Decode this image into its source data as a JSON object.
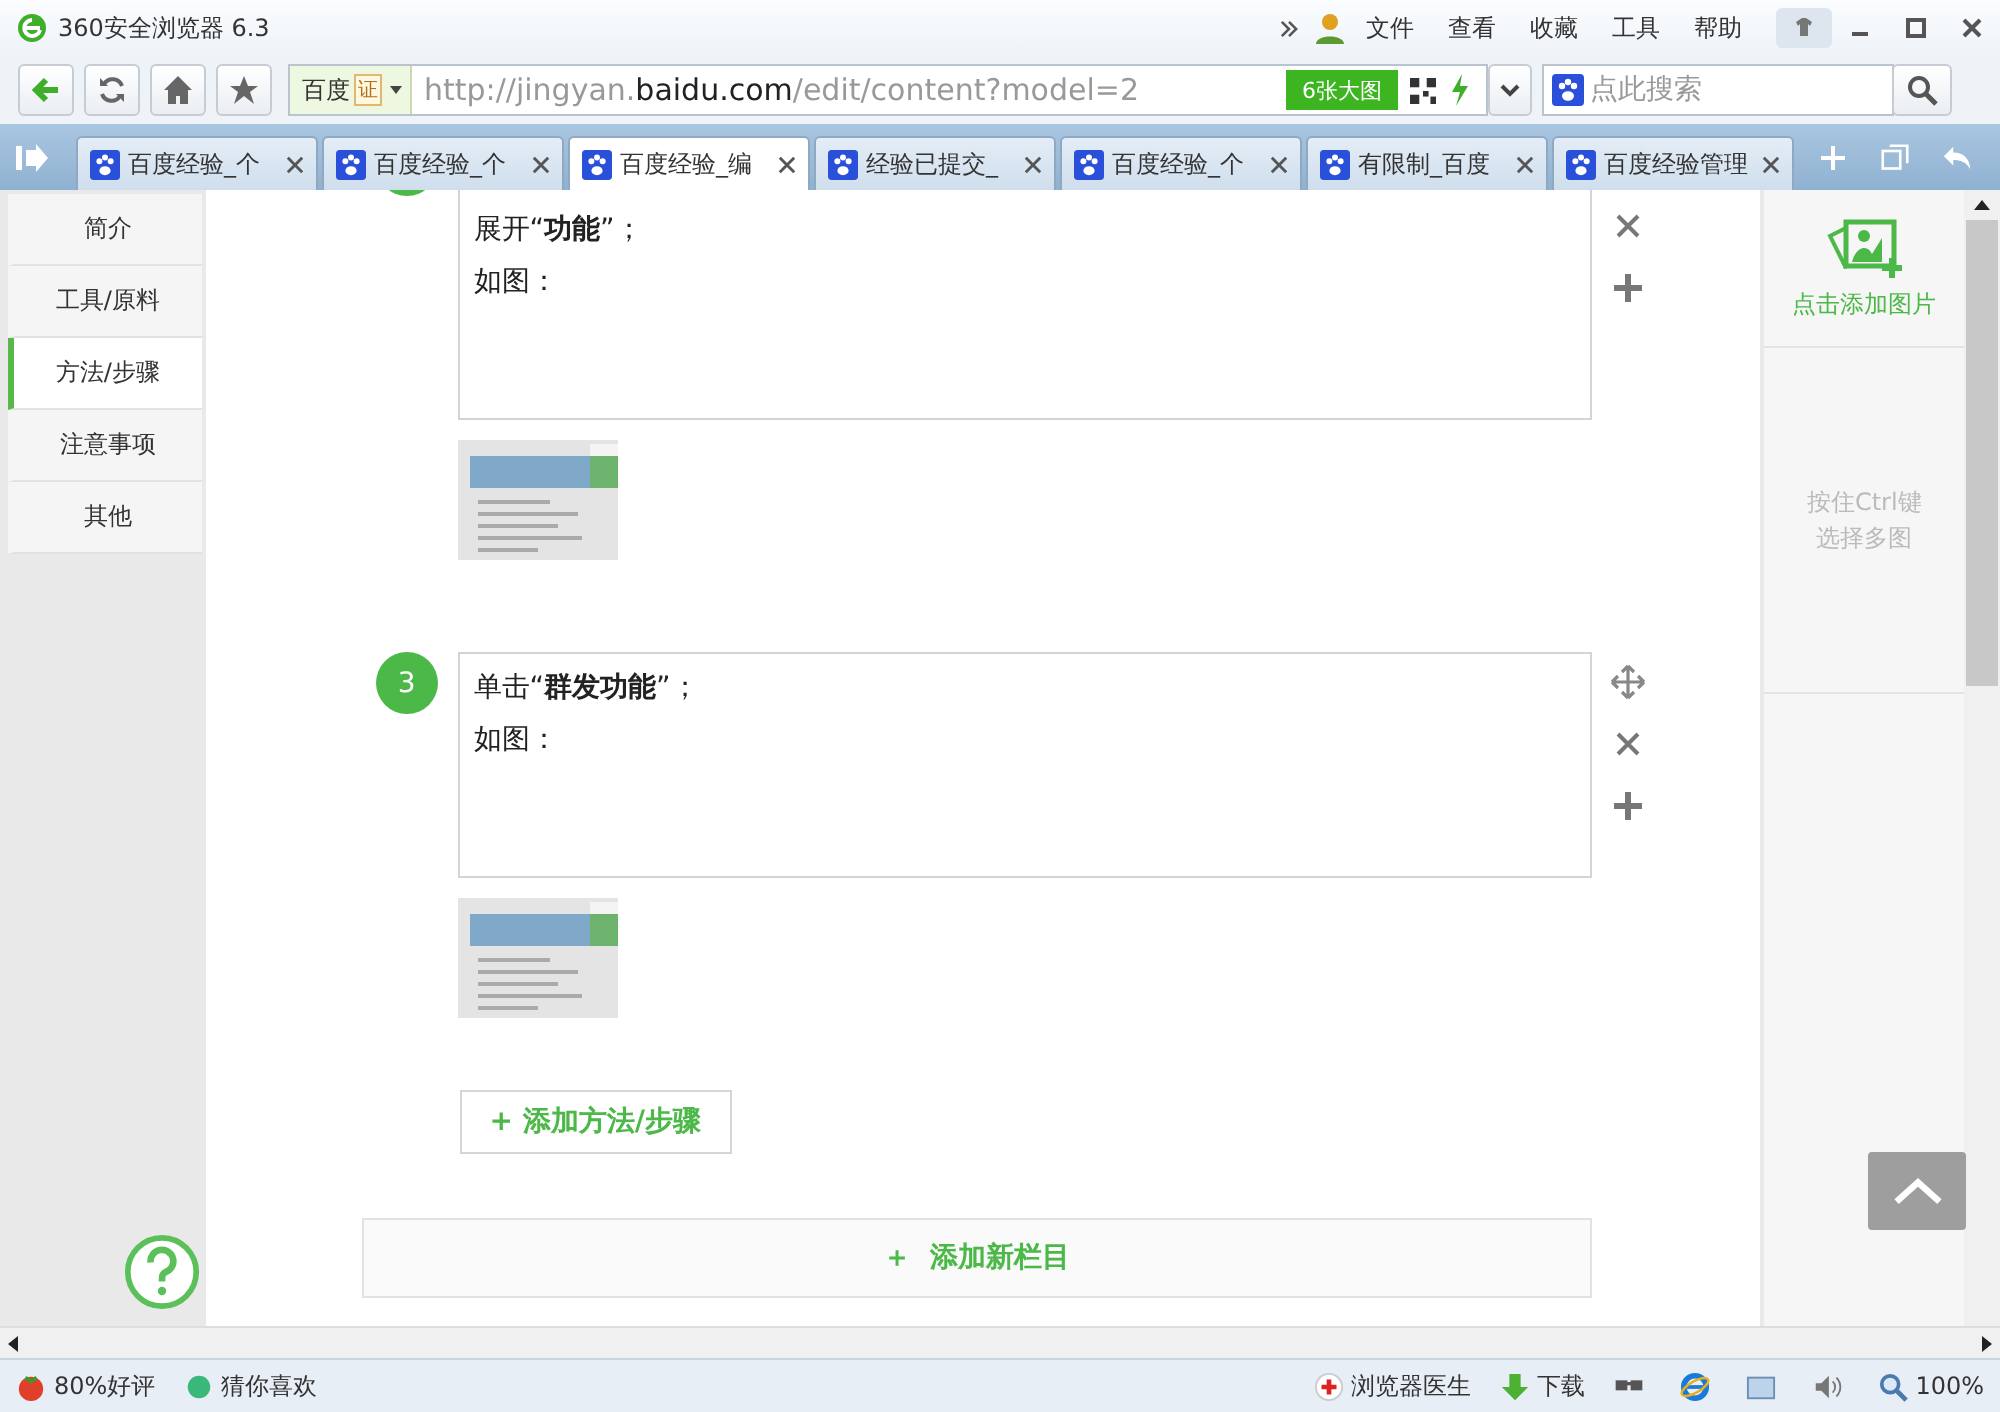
{
  "window": {
    "title": "360安全浏览器 6.3",
    "menu": [
      "文件",
      "查看",
      "收藏",
      "工具",
      "帮助"
    ]
  },
  "address_bar": {
    "engine": "百度",
    "cert": "证",
    "url": "http://jingyan.**baidu.com**/edit/content?model=2",
    "image_button": "6张大图"
  },
  "search": {
    "placeholder": "点此搜索"
  },
  "tabs": [
    {
      "label": "百度经验_个",
      "selected": false
    },
    {
      "label": "百度经验_个",
      "selected": false
    },
    {
      "label": "百度经验_编",
      "selected": true
    },
    {
      "label": "经验已提交_",
      "selected": false
    },
    {
      "label": "百度经验_个",
      "selected": false
    },
    {
      "label": "有限制_百度",
      "selected": false
    },
    {
      "label": "百度经验管理",
      "selected": false
    }
  ],
  "sidebar": {
    "items": [
      {
        "label": "简介",
        "selected": false
      },
      {
        "label": "工具/原料",
        "selected": false
      },
      {
        "label": "方法/步骤",
        "selected": true
      },
      {
        "label": "注意事项",
        "selected": false
      },
      {
        "label": "其他",
        "selected": false
      }
    ]
  },
  "steps": [
    {
      "text": "展开“**功能**”；",
      "line2": "如图："
    },
    {
      "number": "3",
      "text": "单击“**群发功能**”；",
      "line2": "如图："
    }
  ],
  "add_step_button": "+ 添加方法/步骤",
  "add_section_button": "＋  添加新栏目",
  "image_panel": {
    "add_label": "点击添加图片",
    "hint_lines": [
      "按住Ctrl键",
      "选择多图"
    ]
  },
  "status_bar": {
    "rating": "80%好评",
    "recommend": "猜你喜欢",
    "doctor": "浏览器医生",
    "download": "下载",
    "zoom": "100%"
  }
}
